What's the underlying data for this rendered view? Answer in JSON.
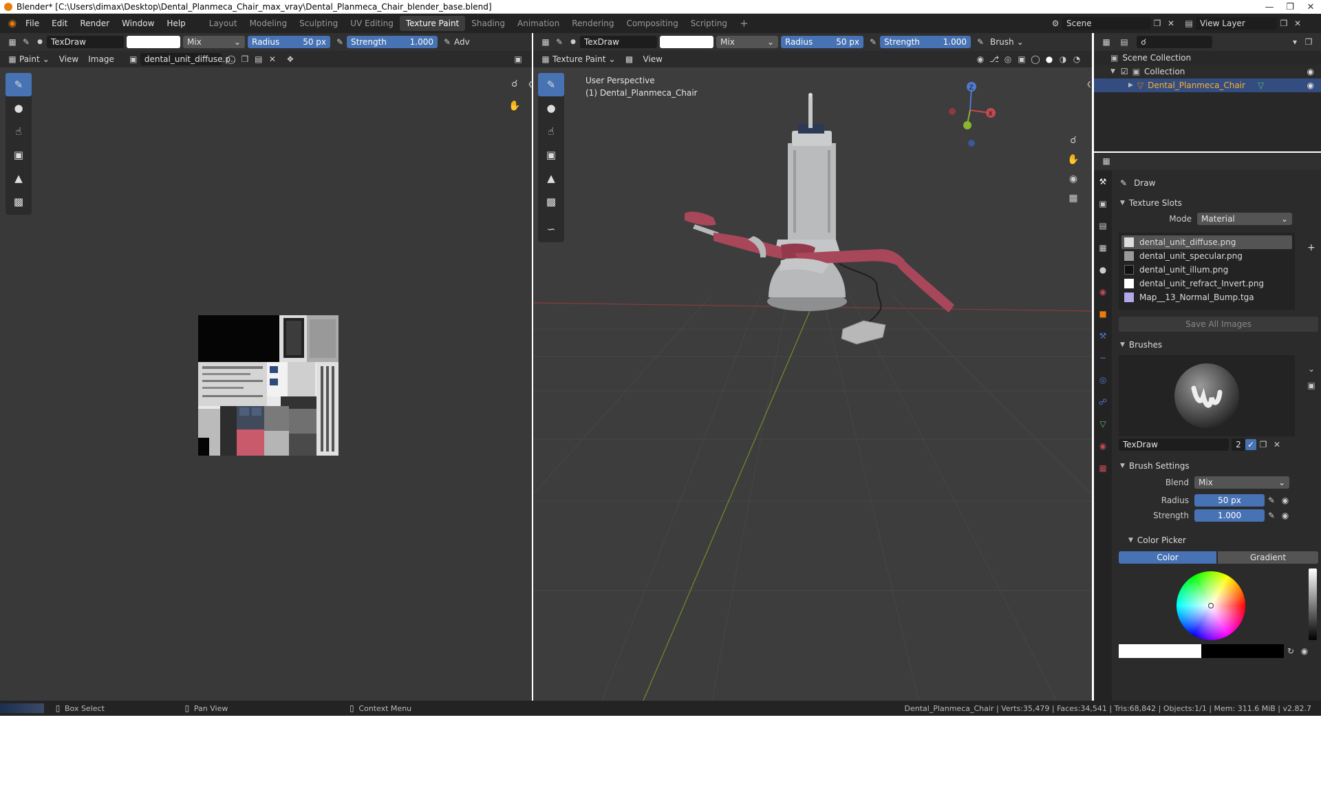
{
  "window": {
    "title": "Blender* [C:\\Users\\dimax\\Desktop\\Dental_Planmeca_Chair_max_vray\\Dental_Planmeca_Chair_blender_base.blend]"
  },
  "menubar": {
    "menus": [
      "File",
      "Edit",
      "Render",
      "Window",
      "Help"
    ],
    "workspaces": [
      "Layout",
      "Modeling",
      "Sculpting",
      "UV Editing",
      "Texture Paint",
      "Shading",
      "Animation",
      "Rendering",
      "Compositing",
      "Scripting"
    ],
    "add_workspace": "+",
    "scene": "Scene",
    "view_layer": "View Layer"
  },
  "image_editor": {
    "brush_name": "TexDraw",
    "blend": "Mix",
    "radius_label": "Radius",
    "radius_value": "50 px",
    "strength_label": "Strength",
    "strength_value": "1.000",
    "adv_label": "Adv",
    "mode": "Paint",
    "menus": [
      "View",
      "Image"
    ],
    "image_name": "dental_unit_diffuse.p..",
    "colors": {
      "texture_red": "#c85a6c"
    }
  },
  "viewport": {
    "brush_name": "TexDraw",
    "blend": "Mix",
    "radius_label": "Radius",
    "radius_value": "50 px",
    "strength_label": "Strength",
    "strength_value": "1.000",
    "brush_dropdown": "Brush",
    "mode": "Texture Paint",
    "view_menu": "View",
    "perspective": "User Perspective",
    "object_label": "(1) Dental_Planmeca_Chair",
    "gizmo": {
      "z": "Z",
      "x": "X"
    },
    "colors": {
      "upholstery": "#a8475a",
      "body": "#b7b9ba",
      "x_axis": "#c14a52",
      "y_axis": "#8ab52e"
    }
  },
  "outliner": {
    "scene_collection": "Scene Collection",
    "collection": "Collection",
    "object": "Dental_Planmeca_Chair"
  },
  "properties": {
    "tool_name": "Draw",
    "texture_slots_title": "Texture Slots",
    "mode_label": "Mode",
    "mode_value": "Material",
    "slots": [
      "dental_unit_diffuse.png",
      "dental_unit_specular.png",
      "dental_unit_illum.png",
      "dental_unit_refract_Invert.png",
      "Map__13_Normal_Bump.tga"
    ],
    "save_all": "Save All Images",
    "brushes_title": "Brushes",
    "brush_name": "TexDraw",
    "brush_users": "2",
    "brush_settings_title": "Brush Settings",
    "blend_label": "Blend",
    "blend_value": "Mix",
    "radius_label": "Radius",
    "radius_value": "50 px",
    "strength_label": "Strength",
    "strength_value": "1.000",
    "color_picker_title": "Color Picker",
    "color_tab": "Color",
    "gradient_tab": "Gradient"
  },
  "statusbar": {
    "box_select": "Box Select",
    "pan_view": "Pan View",
    "context_menu": "Context Menu",
    "stats": "Dental_Planmeca_Chair | Verts:35,479 | Faces:34,541 | Tris:68,842 | Objects:1/1 | Mem: 311.6 MiB | v2.82.7"
  }
}
